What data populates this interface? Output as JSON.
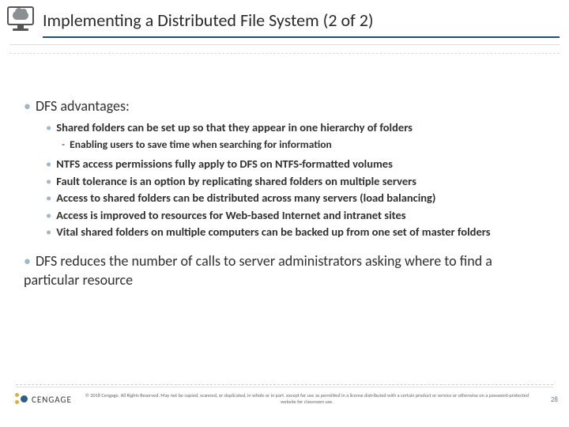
{
  "header": {
    "title": "Implementing a Distributed File System (2 of 2)"
  },
  "content": {
    "section1": {
      "heading": "DFS advantages:",
      "items": [
        {
          "text": "Shared folders can be set up so that they appear in one hierarchy of folders",
          "sub": "Enabling users to save time when searching for information"
        },
        {
          "text": "NTFS access permissions fully apply to DFS on NTFS-formatted volumes"
        },
        {
          "text": "Fault tolerance is an option by replicating shared folders on multiple servers"
        },
        {
          "text": "Access to shared folders can be distributed across many servers (load balancing)"
        },
        {
          "text": "Access is improved to resources for Web-based Internet and intranet sites"
        },
        {
          "text": "Vital shared folders on multiple computers can be backed up from one set of master folders"
        }
      ]
    },
    "section2": {
      "heading": "DFS reduces the number of calls to server administrators asking where to find a particular resource"
    }
  },
  "footer": {
    "brand": "CENGAGE",
    "copyright": "© 2018 Cengage. All Rights Reserved. May not be copied, scanned, or duplicated, in whole or in part, except for use as permitted in a license distributed with a certain product or service or otherwise on a password-protected website for classroom use.",
    "page": "28"
  }
}
